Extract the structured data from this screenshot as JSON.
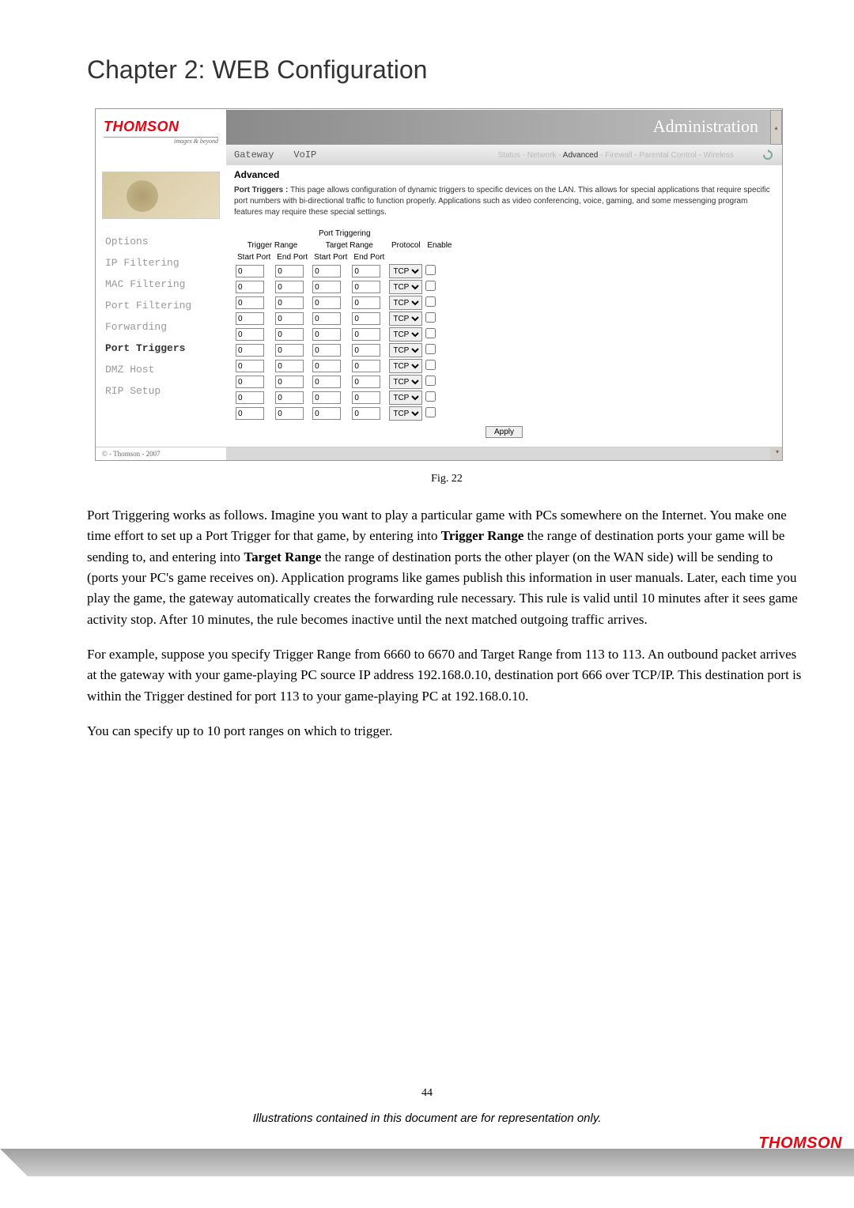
{
  "chapter_title": "Chapter 2: WEB Configuration",
  "ui": {
    "brand": "THOMSON",
    "tagline": "images & beyond",
    "header_title": "Administration",
    "nav_main": [
      "Gateway",
      "VoIP"
    ],
    "nav_sub": [
      "Status",
      "Network",
      "Advanced",
      "Firewall",
      "Parental Control",
      "Wireless"
    ],
    "nav_sub_active": "Advanced",
    "sidebar_items": [
      "Options",
      "IP Filtering",
      "MAC Filtering",
      "Port Filtering",
      "Forwarding",
      "Port Triggers",
      "DMZ Host",
      "RIP Setup"
    ],
    "sidebar_active": "Port Triggers",
    "section_title": "Advanced",
    "port_triggers_label": "Port Triggers :",
    "port_triggers_desc": " This page allows configuration of dynamic triggers to specific devices on the LAN. This allows for special applications that require specific port numbers with bi-directional traffic to function properly. Applications such as video conferencing, voice, gaming, and some messenging program features may require these special settings.",
    "table_super_header": "Port Triggering",
    "table_headers": {
      "trigger_range": "Trigger Range",
      "target_range": "Target Range",
      "protocol": "Protocol",
      "enable": "Enable",
      "start_port": "Start Port",
      "end_port": "End Port"
    },
    "row_default": {
      "start1": "0",
      "end1": "0",
      "start2": "0",
      "end2": "0",
      "proto": "TCP"
    },
    "row_count": 10,
    "apply_label": "Apply",
    "copyright": "© - Thomson - 2007"
  },
  "fig_caption": "Fig. 22",
  "para1_a": "Port Triggering works as follows. Imagine you want to play a particular game with PCs somewhere on the Internet. You make one time effort to set up a Port Trigger for that game, by entering into ",
  "para1_b1": "Trigger Range",
  "para1_c": " the range of destination ports your game will be sending to, and entering into ",
  "para1_b2": "Target Range",
  "para1_d": " the range of destination ports the other player (on the WAN side) will be sending to (ports your PC's game receives on). Application programs like games publish this information in user manuals. Later, each time you play the game, the gateway automatically creates the forwarding rule necessary. This rule is valid until 10 minutes after it sees game activity stop. After 10 minutes, the rule becomes inactive until the next matched outgoing traffic arrives.",
  "para2": "For example, suppose you specify Trigger Range from 6660 to 6670 and Target Range from 113 to 113. An outbound packet arrives at the gateway with your game-playing PC source IP address 192.168.0.10, destination port 666 over TCP/IP. This destination port is within the Trigger destined for port 113 to your game-playing PC at 192.168.0.10.",
  "para3": "You can specify up to 10 port ranges on which to trigger.",
  "page_num": "44",
  "footer_note": "Illustrations contained in this document are for representation only.",
  "footer_brand": "THOMSON"
}
